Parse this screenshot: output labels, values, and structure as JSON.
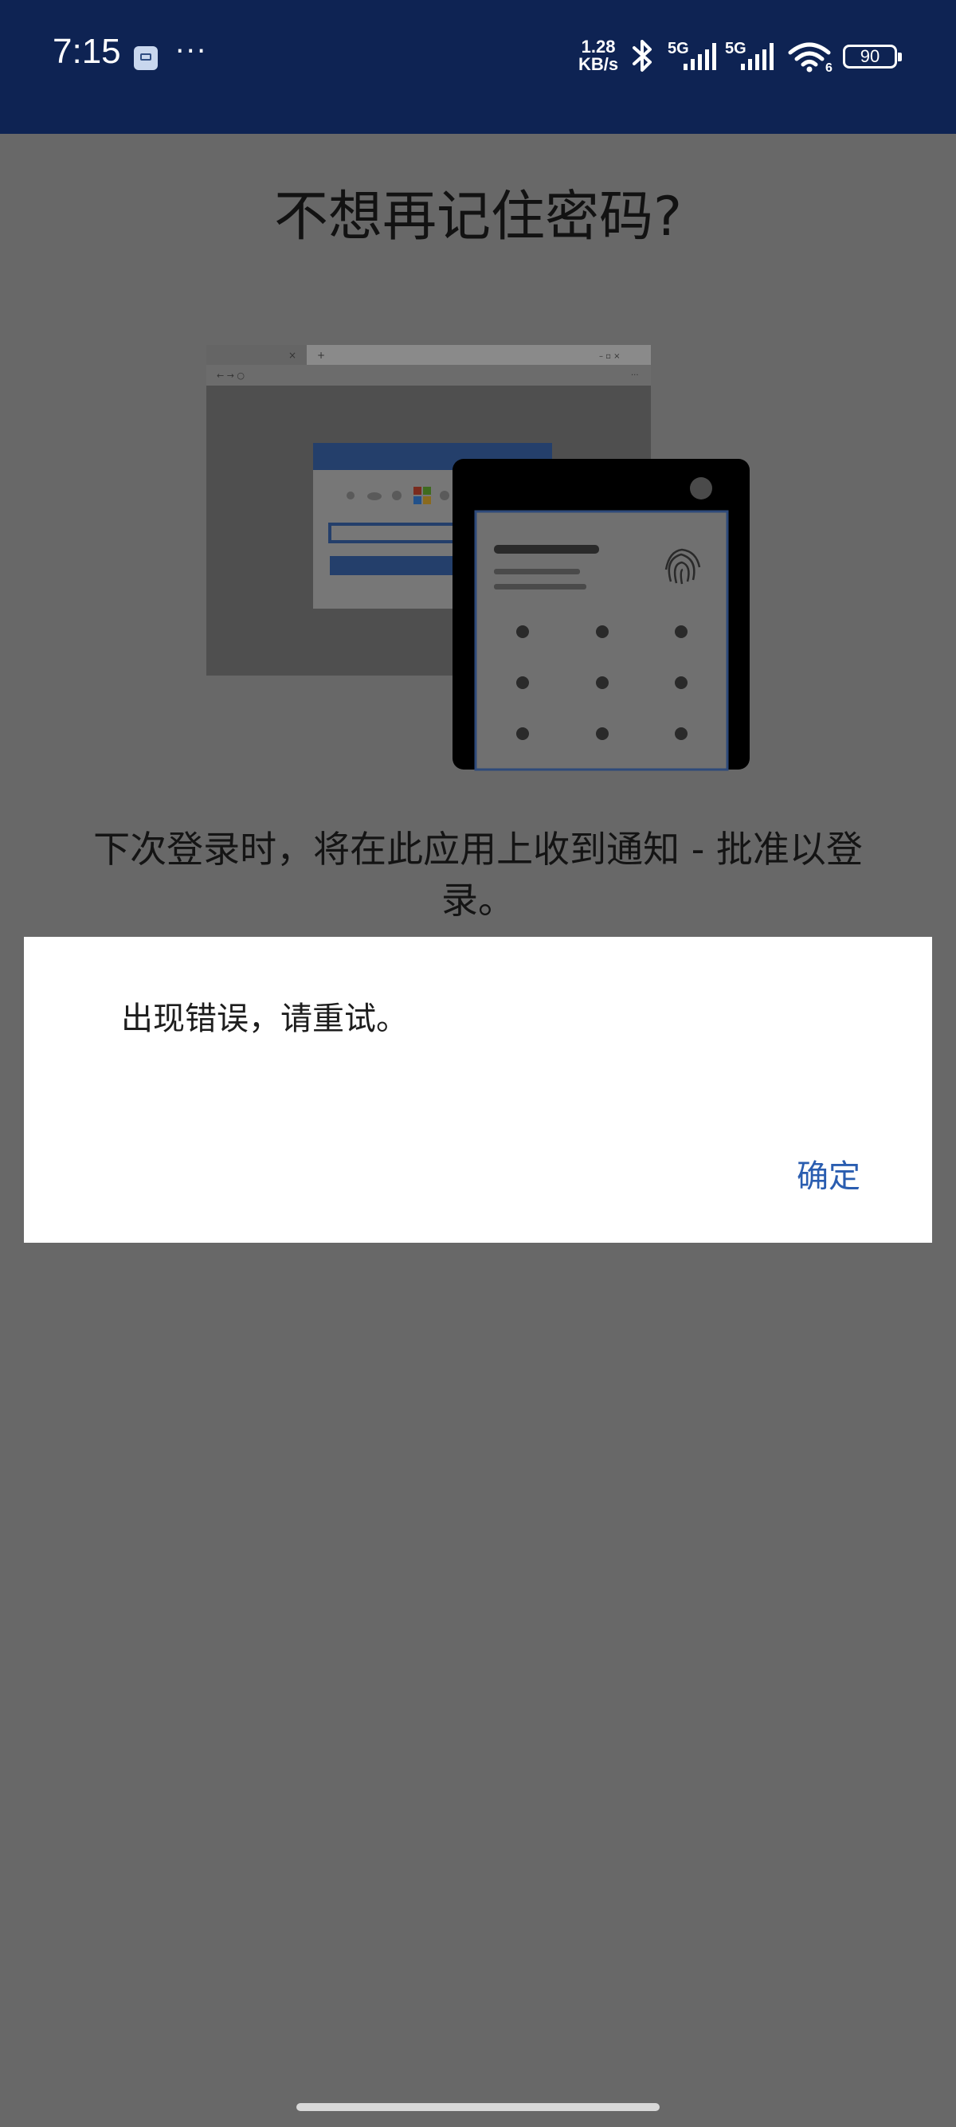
{
  "status_bar": {
    "time": "7:15",
    "more_indicator": "···",
    "net_speed_value": "1.28",
    "net_speed_unit": "KB/s",
    "sim1_label": "5G",
    "sim2_label": "5G",
    "wifi_badge": "6",
    "battery": "90"
  },
  "page": {
    "title": "不想再记住密码?",
    "description": "下次登录时，将在此应用上收到通知 - 批准以登录。"
  },
  "dialog": {
    "message": "出现错误，请重试。",
    "ok_label": "确定"
  },
  "colors": {
    "status_bar_bg": "#0e2353",
    "overlay_bg": "#686868",
    "accent": "#2a5db0"
  },
  "icons": [
    "message-icon",
    "bluetooth-icon",
    "signal-icon",
    "wifi-icon",
    "battery-icon",
    "fingerprint-icon"
  ]
}
